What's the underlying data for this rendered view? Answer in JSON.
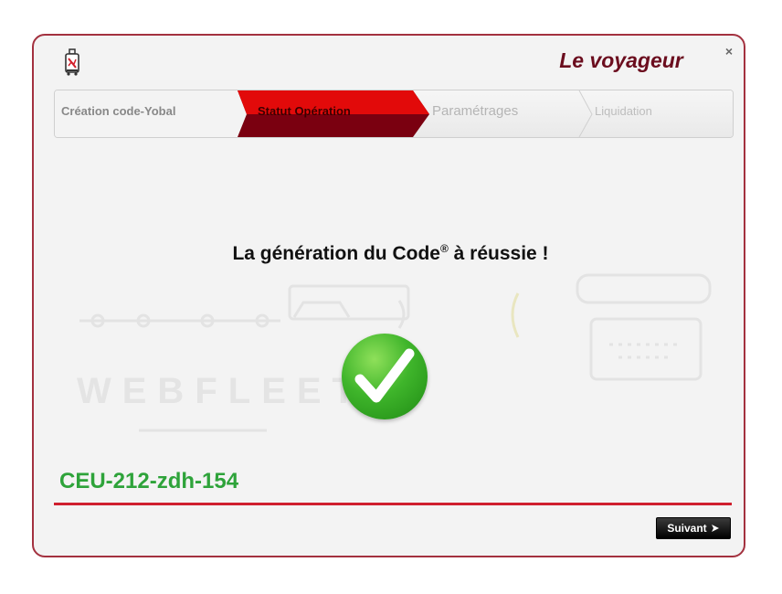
{
  "window": {
    "title": "Le voyageur",
    "close_symbol": "×"
  },
  "wizard": {
    "steps": [
      {
        "label": "Création code-Yobal",
        "state": "done"
      },
      {
        "label": "Statut Opération",
        "state": "active"
      },
      {
        "label": "Paramétrages",
        "state": "pending"
      },
      {
        "label": "Liquidation",
        "state": "pending"
      }
    ],
    "active_color": "#7a0010",
    "active_highlight": "#e20a0a"
  },
  "watermark": {
    "text": "WEBFLEET"
  },
  "main": {
    "message_before": "La génération du Code",
    "message_mark": "®",
    "message_after": " à réussie !",
    "code": "CEU-212-zdh-154",
    "code_color": "#2ea33a"
  },
  "footer": {
    "next_label": "Suivant",
    "next_icon": "arrow-right-icon"
  },
  "colors": {
    "border": "#a3313f",
    "title": "#6b0d1e",
    "rule": "#cf1f2e"
  }
}
